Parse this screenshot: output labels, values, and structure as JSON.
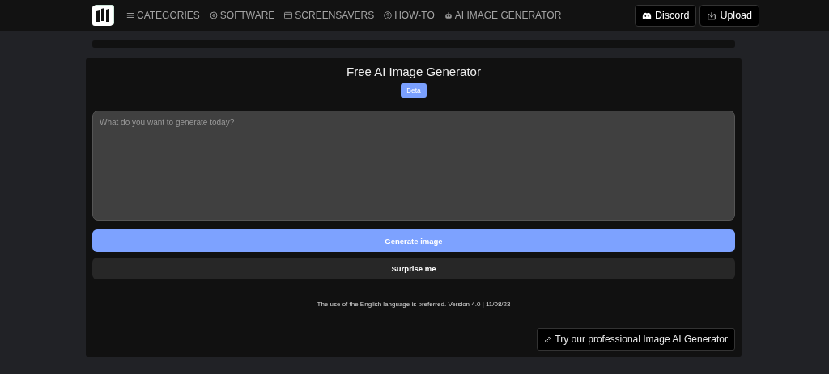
{
  "nav": {
    "items": [
      {
        "label": "CATEGORIES",
        "kind": "menu"
      },
      {
        "label": "SOFTWARE",
        "kind": "disc"
      },
      {
        "label": "SCREENSAVERS",
        "kind": "window"
      },
      {
        "label": "HOW-TO",
        "kind": "help"
      },
      {
        "label": "AI IMAGE GENERATOR",
        "kind": "robot"
      }
    ],
    "buttons": [
      {
        "label": "Discord",
        "kind": "discord"
      },
      {
        "label": "Upload",
        "kind": "upload"
      }
    ]
  },
  "generator": {
    "title": "Free AI Image Generator",
    "badge": "Beta",
    "prompt": {
      "placeholder": "What do you want to generate today?"
    },
    "primary_button": "Generate image",
    "secondary_button": "Surprise me",
    "note": "The use of the English language is preferred. Version 4.0 | 11/08/23",
    "link": "Try our professional Image AI Generator"
  }
}
